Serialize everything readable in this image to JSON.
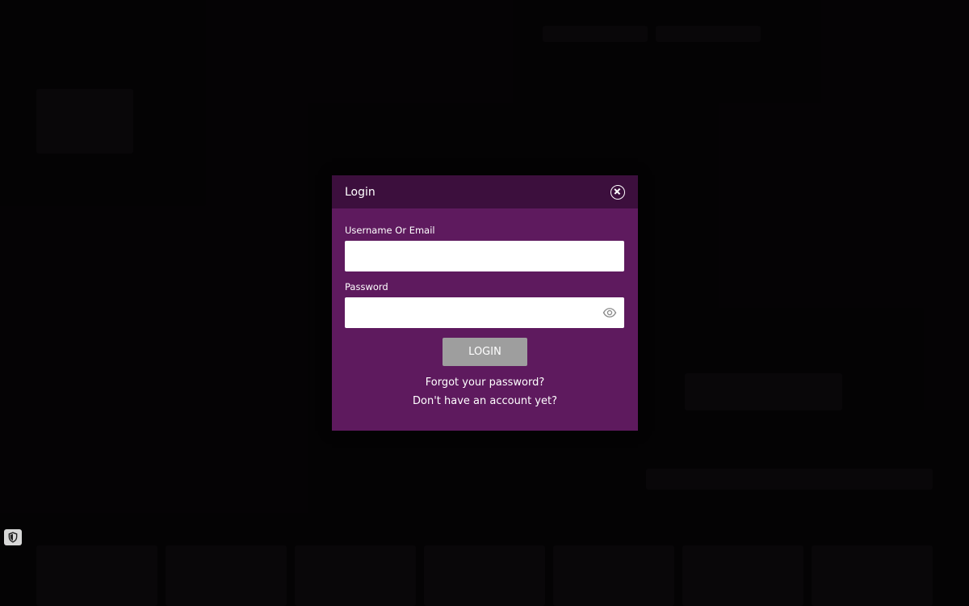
{
  "modal": {
    "title": "Login",
    "username_label": "Username Or Email",
    "username_value": "",
    "password_label": "Password",
    "password_value": "",
    "login_label": "LOGIN",
    "forgot_link": "Forgot your password?",
    "signup_link": "Don't have an account yet?"
  },
  "colors": {
    "modal_body": "#5e1a5e",
    "modal_header": "#3c0f3d",
    "login_button": "#9e9e9e"
  },
  "icons": {
    "close": "close-circle-icon",
    "password_toggle": "eye-icon",
    "privacy": "shield-icon"
  }
}
